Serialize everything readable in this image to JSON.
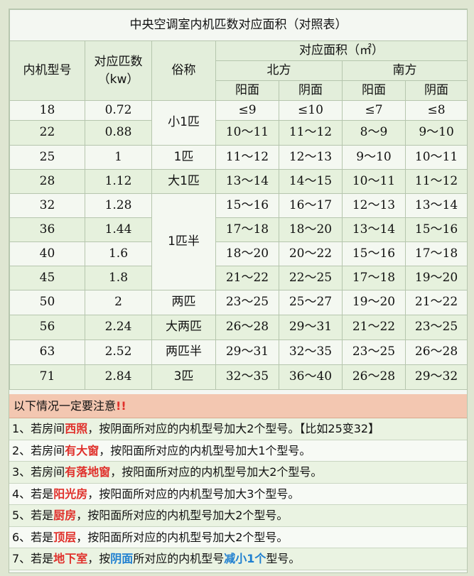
{
  "title": "中央空调室内机匹数对应面积（对照表）",
  "headers": {
    "model": "内机型号",
    "power": "对应匹数\n（kw）",
    "alias": "俗称",
    "area": "对应面积（㎡）",
    "north": "北方",
    "south": "南方",
    "sunny": "阳面",
    "shady": "阴面"
  },
  "rows": [
    {
      "model": "18",
      "kw": "0.72",
      "n_sun": "≤9",
      "n_shade": "≤10",
      "s_sun": "≤7",
      "s_shade": "≤8"
    },
    {
      "model": "22",
      "kw": "0.88",
      "n_sun": "10～11",
      "n_shade": "11～12",
      "s_sun": "8～9",
      "s_shade": "9～10"
    },
    {
      "model": "25",
      "kw": "1",
      "n_sun": "11～12",
      "n_shade": "12～13",
      "s_sun": "9～10",
      "s_shade": "10～11"
    },
    {
      "model": "28",
      "kw": "1.12",
      "n_sun": "13～14",
      "n_shade": "14～15",
      "s_sun": "10～11",
      "s_shade": "11～12"
    },
    {
      "model": "32",
      "kw": "1.28",
      "n_sun": "15～16",
      "n_shade": "16～17",
      "s_sun": "12～13",
      "s_shade": "13～14"
    },
    {
      "model": "36",
      "kw": "1.44",
      "n_sun": "17～18",
      "n_shade": "18～20",
      "s_sun": "13～14",
      "s_shade": "15～16"
    },
    {
      "model": "40",
      "kw": "1.6",
      "n_sun": "18～20",
      "n_shade": "20～22",
      "s_sun": "15～16",
      "s_shade": "17～18"
    },
    {
      "model": "45",
      "kw": "1.8",
      "n_sun": "21～22",
      "n_shade": "22～25",
      "s_sun": "17～18",
      "s_shade": "19～20"
    },
    {
      "model": "50",
      "kw": "2",
      "n_sun": "23～25",
      "n_shade": "25～27",
      "s_sun": "19～20",
      "s_shade": "21～22"
    },
    {
      "model": "56",
      "kw": "2.24",
      "n_sun": "26～28",
      "n_shade": "29～31",
      "s_sun": "21～22",
      "s_shade": "23～25"
    },
    {
      "model": "63",
      "kw": "2.52",
      "n_sun": "29～31",
      "n_shade": "32～35",
      "s_sun": "23～25",
      "s_shade": "26～28"
    },
    {
      "model": "71",
      "kw": "2.84",
      "n_sun": "32～35",
      "n_shade": "36～40",
      "s_sun": "26～28",
      "s_shade": "29～32"
    }
  ],
  "aliases": {
    "a1": "小1匹",
    "a2": "1匹",
    "a3": "大1匹",
    "a4": "1匹半",
    "a5": "两匹",
    "a6": "大两匹",
    "a7": "两匹半",
    "a8": "3匹"
  },
  "notes_heading": "以下情况一定要注意",
  "notes_heading_mark": "!!",
  "notes": [
    {
      "pre": "1、若房间",
      "hl": "西照",
      "post": "，按阴面所对应的内机型号加大2个型号。【比如25变32】"
    },
    {
      "pre": "2、若房间",
      "hl": "有大窗",
      "post": "，按阳面所对应的内机型号加大1个型号。"
    },
    {
      "pre": "3、若房间",
      "hl": "有落地窗",
      "post": "，按阳面所对应的内机型号加大2个型号。"
    },
    {
      "pre": "4、若是",
      "hl": "阳光房",
      "post": "，按阳面所对应的内机型号加大3个型号。"
    },
    {
      "pre": "5、若是",
      "hl": "厨房",
      "post": "，按阳面所对应的内机型号加大2个型号。"
    },
    {
      "pre": "6、若是",
      "hl": "顶层",
      "post": "，按阳面所对应的内机型号加大2个型号。"
    }
  ],
  "note7": {
    "pre": "7、若是",
    "hl1": "地下室",
    "mid": "，按",
    "hl2": "阴面",
    "mid2": "所对应的内机型号",
    "hl3": "减小1个",
    "post": "型号。"
  },
  "colors": {
    "accent_red": "#e0302b",
    "accent_blue": "#1e7fd0",
    "note_banner": "#f3c7b1",
    "row_tint": "#e6f1dd"
  }
}
